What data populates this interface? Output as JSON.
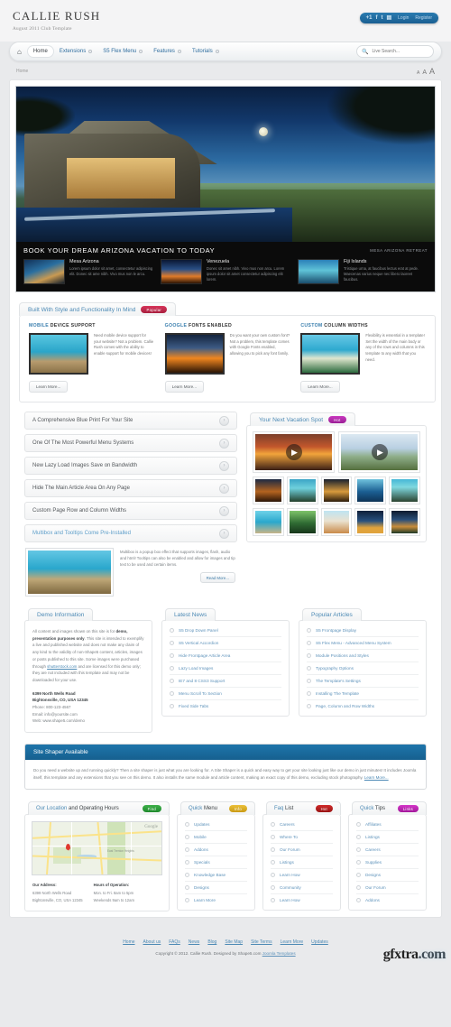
{
  "header": {
    "logo": "CALLIE RUSH",
    "tagline": "August 2011 Club Template",
    "social": {
      "gplus": "+1",
      "facebook": "f",
      "twitter": "t",
      "rss": "▤",
      "login": "Login",
      "register": "Register"
    }
  },
  "nav": {
    "home_icon": "⌂",
    "items": [
      {
        "label": "Home",
        "active": true,
        "has_caret": false
      },
      {
        "label": "Extensions",
        "active": false,
        "has_caret": true
      },
      {
        "label": "S5 Flex Menu",
        "active": false,
        "has_caret": true
      },
      {
        "label": "Features",
        "active": false,
        "has_caret": true
      },
      {
        "label": "Tutorials",
        "active": false,
        "has_caret": true
      }
    ],
    "search_placeholder": "Live Search...",
    "search_value": ""
  },
  "breadcrumb": {
    "current": "Home",
    "font_small": "A",
    "font_medium": "A",
    "font_large": "A"
  },
  "hero": {
    "title": "BOOK YOUR DREAM ARIZONA VACATION TO TODAY",
    "subtitle": "MESA ARIZONA RETREAT",
    "thumbs": [
      {
        "title": "Mesa Arizona",
        "text": "Lorem ipsum dolor sit amet, consectetur adipiscing elit. Donec sit ame nibh. Vivo mus non le arcu."
      },
      {
        "title": "Venezuela",
        "text": "Donec sit amet nibh. Vivo mus non arcu. Lorem ipsum dolor sit amet consectetur adipiscing elit lorem."
      },
      {
        "title": "Fiji Islands",
        "text": "Tristique urna, at faucibus lectus erat at pede. Maecenas varius neque nec libero laoreet faucibus."
      }
    ]
  },
  "features_section": {
    "title": "Built With Style and Functionality In Mind",
    "badge": "Popular",
    "columns": [
      {
        "title_accent": "MOBILE",
        "title_rest": " DEVICE SUPPORT",
        "text": "Need mobile device support for your website? Not a problem. Callie Rush comes with the ability to enable support for mobile devices!",
        "button": "Learn More..."
      },
      {
        "title_accent": "GOOGLE",
        "title_rest": " FONTS ENABLED",
        "text": "Do you want your own custom font? Not a problem, this template comes with Google Fonts enabled, allowing you to pick any font family.",
        "button": "Learn More..."
      },
      {
        "title_accent": "CUSTOM",
        "title_rest": " COLUMN WIDTHS",
        "text": "Flexibility is essential in a template! Set the width of the main body or any of the rows and columns in this template to any width that you need.",
        "button": "Learn More..."
      }
    ]
  },
  "accordion": {
    "items": [
      {
        "label": "A Comprehensive Blue Print For Your Site",
        "open": false
      },
      {
        "label": "One Of The Most Powerful Menu Systems",
        "open": false
      },
      {
        "label": "New Lazy Load Images Save on Bandwidth",
        "open": false
      },
      {
        "label": "Hide The Main Article Area On Any Page",
        "open": false
      },
      {
        "label": "Custom Page Row and Column Widths",
        "open": false
      },
      {
        "label": "Multibox and Tooltips Come Pre-Installed",
        "open": true
      }
    ],
    "open_text": "Multibox is a popup box effect that supports images, flash, audio and html! Tooltips can also be enabled and allow for images and tip text to be used and certain items.",
    "read_more": "Read More..."
  },
  "gallery_section": {
    "title": "Your Next Vacation Spot",
    "badge": "Hot",
    "play_icon": "▶",
    "video_count": 2,
    "thumb_count": 10
  },
  "demo_info": {
    "title": "Demo Information",
    "p1_a": "All content and images shown on this site is for ",
    "p1_b": "demo, presentation purposes only",
    "p1_c": ". This site is intended to exemplify a live and published website and does not make any claim of any kind to the validity of non-Shape5 content, articles, images or posts published to this site. Some images were purchased through ",
    "p1_link": "shutterstock.com",
    "p1_d": " and are licensed for this demo only; they are not included with this template and may not be downloaded for your use.",
    "address_line1": "6399 North Wells Road",
    "address_line2": "Bightonsville, CO, USA 12345",
    "phone": "Phone: 800-123-4567",
    "email": "Email: info@yoursite.com",
    "web": "Web: www.shape5.com/demo"
  },
  "latest_news": {
    "title": "Latest News",
    "items": [
      "S5 Drop Down Panel",
      "S5 Vertical Accordion",
      "Hide Frontpage Article Area",
      "Lazy Load Images",
      "IE7 and 8 CSS3 Support",
      "Menu Scroll To Section",
      "Fixed Side Tabs"
    ]
  },
  "popular_articles": {
    "title": "Popular Articles",
    "items": [
      "S5 Frontpage Display",
      "S5 Flex Menu - Advanced Menu System",
      "Module Positions and Styles",
      "Typography Options",
      "The Template's Settings",
      "Installing The Template",
      "Page, Column and Row Widths"
    ]
  },
  "site_shaper": {
    "title": "Site Shaper Available",
    "text": "Do you need a website up and running quickly? Then a site shaper is just what you are looking for. A Site Shaper is a quick and easy way to get your site looking just like our demo in just minutes! It includes Joomla itself, this template and any extensions that you see on this demo. It also installs the same module and article content, making an exact copy of this demo, excluding stock photography. ",
    "link": "Learn More..."
  },
  "location": {
    "title_accent": "Our Location",
    "title_rest": " and Operating Hours",
    "badge": "Find",
    "map_logo": "Google",
    "map_label": "East Trenton Heights",
    "address_head": "Our Address:",
    "address_line1": "6399 North Wells Road",
    "address_line2": "Bightonsville, CO, USA 12345",
    "hours_head": "Hours of Operation:",
    "hours_line1": "Mon. to Fri. 8am to 5pm",
    "hours_line2": "Weekends 9am to 12am"
  },
  "quick_menu": {
    "title_accent": "Quick",
    "title_rest": " Menu",
    "badge": "Info",
    "items": [
      "Updates",
      "Mobile",
      "Addons",
      "Specials",
      "Knowledge Base",
      "Designs",
      "Learn More"
    ]
  },
  "faq_list": {
    "title_accent": "Faq",
    "title_rest": " List",
    "badge": "Hot",
    "items": [
      "Careers",
      "Where To",
      "Our Forum",
      "Listings",
      "Learn How",
      "Community",
      "Learn How"
    ]
  },
  "quick_tips": {
    "title_accent": "Quick",
    "title_rest": " Tips",
    "badge": "Links",
    "items": [
      "Affiliates",
      "Listings",
      "Careers",
      "Supplies",
      "Designs",
      "Our Forum",
      "Addons"
    ]
  },
  "footer": {
    "links": [
      "Home",
      "About us",
      "FAQs",
      "News",
      "Blog",
      "Site Map",
      "Site Terms",
      "Learn More",
      "Updates"
    ],
    "copyright": "Copyright © 2012. Callie Rush. Designed by Shape5.com ",
    "copyright_link": "Joomla Templates"
  },
  "watermark": {
    "text": "gfxtra",
    "suffix": ".com"
  },
  "colors": {
    "accent": "#4d8ab5",
    "nav_link": "#2e6d9e",
    "header_blue": "#1e75ab",
    "badge_red": "#c0213f",
    "badge_hot": "#b32aac",
    "badge_find": "#2f9a3c"
  }
}
